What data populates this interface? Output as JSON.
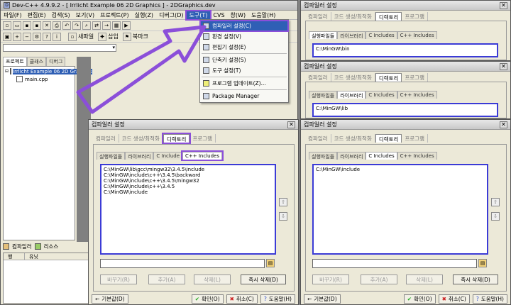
{
  "main": {
    "title": "Dev-C++ 4.9.9.2  - [ Irrlicht Example 06 2D Graphics ] - 2DGraphics.dev",
    "menu": [
      "파일(F)",
      "편집(E)",
      "검색(S)",
      "보기(V)",
      "프로젝트(P)",
      "실행(Z)",
      "디버그(D)",
      "도구(T)",
      "CVS",
      "창(W)",
      "도움말(H)"
    ],
    "toolbar2": [
      "새파일",
      "삽입",
      "북마크"
    ],
    "left_tabs": [
      "프로젝트",
      "클래스",
      "디버그"
    ],
    "tree_root": "Irrlicht Example 06 2D Graphics",
    "tree_file": "main.cpp",
    "bottom_tabs": [
      "컴파일러",
      "리소스"
    ],
    "bottom_cols": [
      "행",
      "유닛"
    ]
  },
  "tools_menu": {
    "items": [
      "컴파일러 설정(C)",
      "환경 설정(V)",
      "편집기 설정(E)",
      "단축키 설정(S)",
      "도구 설정(T)",
      "프로그램 업데이트(Z)...",
      "Package Manager"
    ]
  },
  "dialog_common": {
    "title": "컴파일러 설정",
    "tabs": [
      "컴파일러",
      "코드 생성/최적화",
      "디렉토리",
      "프로그램"
    ],
    "subtabs": [
      "실행파일들",
      "라이브러리",
      "C Includes",
      "C++ Includes"
    ],
    "btn_replace": "바꾸기(R)",
    "btn_add": "추가(A)",
    "btn_delete": "삭제(L)",
    "btn_delete_now": "즉시 삭제(D)",
    "btn_default": "기본값(D)",
    "btn_ok": "확인(O)",
    "btn_cancel": "취소(C)",
    "btn_help": "도움말(H)"
  },
  "dialog_bin": {
    "path": "C:\\MinGW\\bin"
  },
  "dialog_lib": {
    "path": "C:\\MinGW\\lib"
  },
  "dialog_cpp": {
    "paths": [
      "C:\\MinGW\\lib\\gcc\\mingw32\\3.4.5\\include",
      "C:\\MinGW\\include\\c++\\3.4.5\\backward",
      "C:\\MinGW\\include\\c++\\3.4.5\\mingw32",
      "C:\\MinGW\\include\\c++\\3.4.5",
      "C:\\MinGW\\include"
    ],
    "subtab_c_short": "C Include"
  },
  "dialog_c": {
    "path": "C:\\MinGW\\include"
  },
  "colors": {
    "highlight": "#8b4fd9",
    "selection": "#2f5fb5",
    "list_border": "#3b3bd6"
  }
}
